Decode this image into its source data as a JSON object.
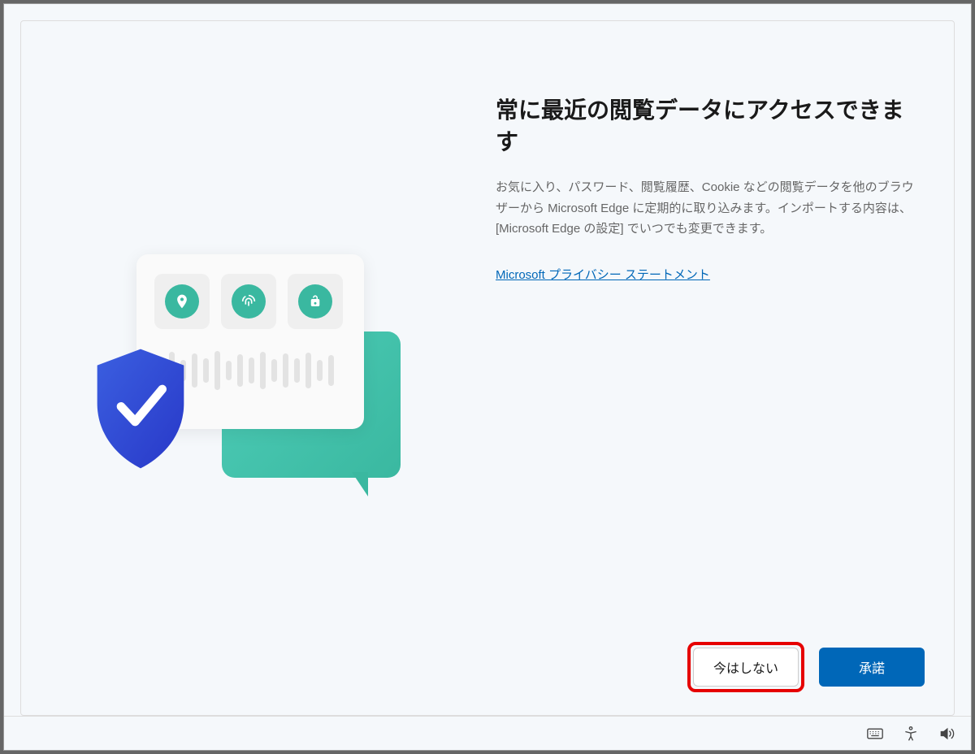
{
  "dialog": {
    "title": "常に最近の閲覧データにアクセスできます",
    "description": "お気に入り、パスワード、閲覧履歴、Cookie などの閲覧データを他のブラウザーから Microsoft Edge に定期的に取り込みます。インポートする内容は、[Microsoft Edge の設定] でいつでも変更できます。",
    "privacy_link_label": "Microsoft プライバシー ステートメント",
    "buttons": {
      "not_now": "今はしない",
      "accept": "承諾"
    }
  },
  "illustration": {
    "icons": [
      "location-pin",
      "fingerprint",
      "lock"
    ]
  },
  "taskbar": {
    "icons": [
      "keyboard",
      "accessibility",
      "volume"
    ]
  }
}
